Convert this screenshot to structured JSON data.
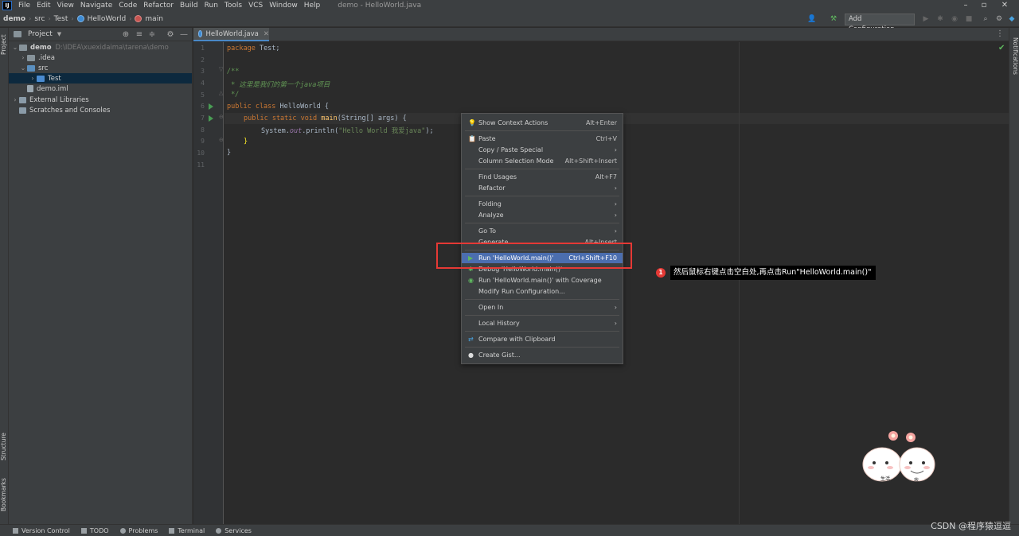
{
  "app": {
    "window_title": "demo - HelloWorld.java",
    "logo_text": "IJ"
  },
  "menu": [
    "File",
    "Edit",
    "View",
    "Navigate",
    "Code",
    "Refactor",
    "Build",
    "Run",
    "Tools",
    "VCS",
    "Window",
    "Help"
  ],
  "breadcrumb": [
    "demo",
    "src",
    "Test",
    "HelloWorld",
    "main"
  ],
  "toolbar": {
    "run_config_label": "Add Configuration..."
  },
  "left_strip": {
    "tabs": [
      "Project",
      "Structure",
      "Bookmarks"
    ]
  },
  "right_strip": {
    "tabs": [
      "Notifications"
    ]
  },
  "project_panel": {
    "title": "Project",
    "tree": [
      {
        "label": "demo",
        "hint": "D:\\IDEA\\xuexidaima\\tarena\\demo"
      },
      {
        "label": ".idea",
        "hint": ""
      },
      {
        "label": "src",
        "hint": ""
      },
      {
        "label": "Test",
        "hint": ""
      },
      {
        "label": "demo.iml",
        "hint": ""
      },
      {
        "label": "External Libraries",
        "hint": ""
      },
      {
        "label": "Scratches and Consoles",
        "hint": ""
      }
    ]
  },
  "editor": {
    "tab_label": "HelloWorld.java",
    "line_numbers": [
      "1",
      "2",
      "3",
      "4",
      "5",
      "6",
      "7",
      "8",
      "9",
      "10",
      "11"
    ],
    "code": {
      "l1_kw": "package",
      "l1_rest": " Test;",
      "l3": "/**",
      "l4": " * 这里是我们的第一个java项目",
      "l5": " */",
      "l6_kw": "public class",
      "l6_rest": " HelloWorld {",
      "l7_kw": "public static void",
      "l7_fn": "main",
      "l7_rest": "(String[] args) {",
      "l8_pre": "System.",
      "l8_static": "out",
      "l8_mid": ".println(",
      "l8_str": "\"Hello World 我爱java\"",
      "l8_end": ");",
      "l9": "}",
      "l10": "}"
    }
  },
  "context_menu": {
    "items": [
      {
        "label": "Show Context Actions",
        "shortcut": "Alt+Enter"
      },
      {
        "label": "Paste",
        "shortcut": "Ctrl+V"
      },
      {
        "label": "Copy / Paste Special",
        "shortcut": "›"
      },
      {
        "label": "Column Selection Mode",
        "shortcut": "Alt+Shift+Insert"
      },
      {
        "label": "Find Usages",
        "shortcut": "Alt+F7"
      },
      {
        "label": "Refactor",
        "shortcut": "›"
      },
      {
        "label": "Folding",
        "shortcut": "›"
      },
      {
        "label": "Analyze",
        "shortcut": "›"
      },
      {
        "label": "Go To",
        "shortcut": "›"
      },
      {
        "label": "Generate...",
        "shortcut": "Alt+Insert"
      },
      {
        "label": "Run 'HelloWorld.main()'",
        "shortcut": "Ctrl+Shift+F10"
      },
      {
        "label": "Debug 'HelloWorld.main()'",
        "shortcut": ""
      },
      {
        "label": "Run 'HelloWorld.main()' with Coverage",
        "shortcut": ""
      },
      {
        "label": "Modify Run Configuration...",
        "shortcut": ""
      },
      {
        "label": "Open In",
        "shortcut": "›"
      },
      {
        "label": "Local History",
        "shortcut": "›"
      },
      {
        "label": "Compare with Clipboard",
        "shortcut": ""
      },
      {
        "label": "Create Gist...",
        "shortcut": ""
      }
    ],
    "highlighted_index": 10
  },
  "annotation": {
    "badge": "1",
    "text": "然后鼠标右键点击空白处,再点击Run\"HelloWorld.main()\""
  },
  "sticker": {
    "left_label": "生活",
    "right_label": "我"
  },
  "statusbar": {
    "items": [
      "Version Control",
      "TODO",
      "Problems",
      "Terminal",
      "Services"
    ],
    "watermark": "CSDN @程序猿逗逗"
  },
  "colors": {
    "accent": "#4b6eaf",
    "highlight_red": "#e53935",
    "background": "#2b2b2b"
  }
}
